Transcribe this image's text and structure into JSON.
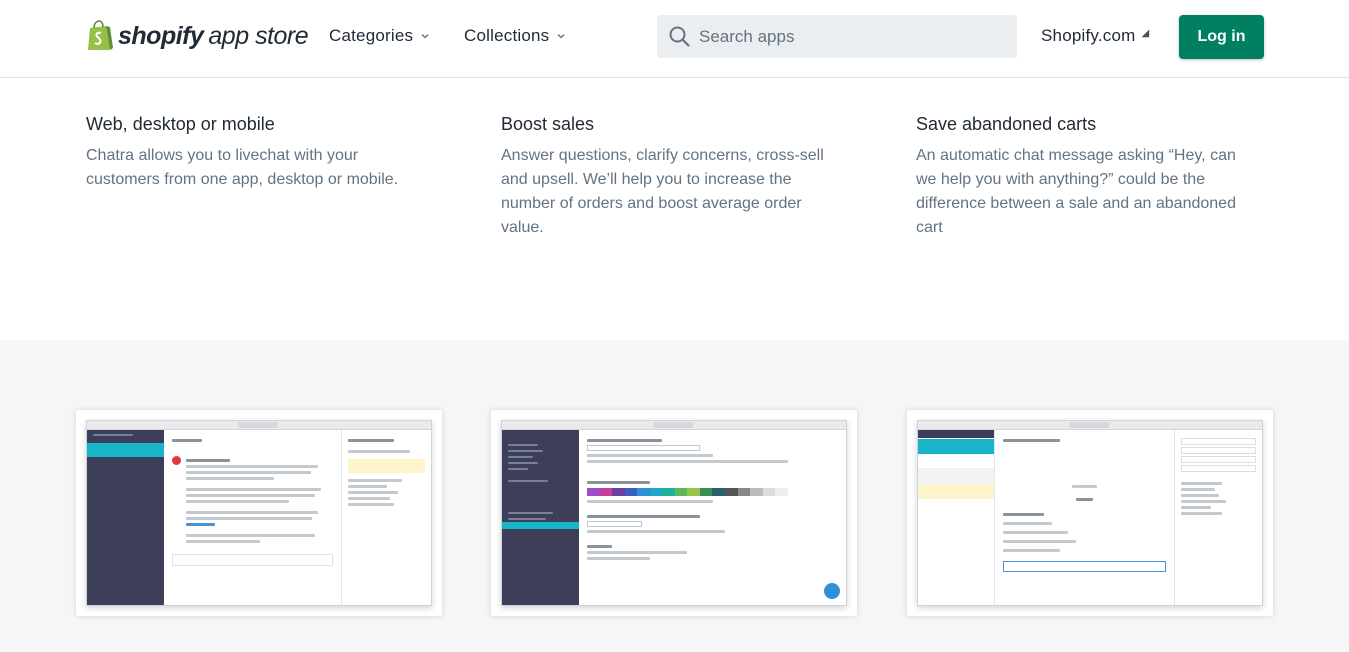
{
  "header": {
    "logo_brand": "shopify",
    "logo_suffix": "app store",
    "nav": [
      {
        "label": "Categories"
      },
      {
        "label": "Collections"
      }
    ],
    "search_placeholder": "Search apps",
    "shopify_link": "Shopify.com",
    "login_label": "Log in"
  },
  "features": [
    {
      "title": "Web, desktop or mobile",
      "text": "Chatra allows you to livechat with your customers from one app, desktop or mobile."
    },
    {
      "title": "Boost sales",
      "text": "Answer questions, clarify concerns, cross-sell and upsell. We’ll help you to increase the number of orders and boost average order value."
    },
    {
      "title": "Save abandoned carts",
      "text": "An automatic chat message asking “Hey, can we help you with anything?” could be the difference between a sale and an abandoned cart"
    }
  ],
  "colors": {
    "brand_green": "#008060",
    "sidebar_dark": "#3d3f5a",
    "accent_teal": "#18b5c8"
  },
  "icons": {
    "logo": "shopify-bag-icon",
    "search": "search-icon",
    "dropdown": "chevron-down-icon",
    "external": "external-link-icon"
  }
}
